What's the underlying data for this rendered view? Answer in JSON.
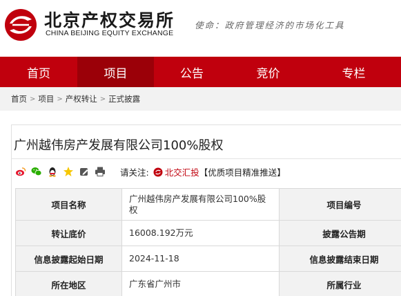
{
  "header": {
    "logo_cn": "北京产权交易所",
    "logo_en": "CHINA BEIJING EQUITY EXCHANGE",
    "mission": "使命：政府管理经济的市场化工具"
  },
  "nav": {
    "items": [
      {
        "label": "首页"
      },
      {
        "label": "项目"
      },
      {
        "label": "公告"
      },
      {
        "label": "竞价"
      },
      {
        "label": "专栏"
      }
    ],
    "active_index": 1
  },
  "breadcrumb": {
    "items": [
      "首页",
      "项目",
      "产权转让",
      "正式披露"
    ],
    "separator": ">"
  },
  "project": {
    "title": "广州越伟房产发展有限公司100%股权"
  },
  "share": {
    "icons": [
      "weibo-icon",
      "wechat-icon",
      "qq-icon",
      "qzone-star-icon",
      "edit-icon",
      "print-icon"
    ],
    "attention_label": "请关注:",
    "bjx_label": "北交汇投",
    "promo_label": "【优质项目精准推送】"
  },
  "info_table": {
    "rows": [
      {
        "label": "项目名称",
        "value": "广州越伟房产发展有限公司100%股权",
        "label2": "项目编号"
      },
      {
        "label": "转让底价",
        "value": "16008.192万元",
        "label2": "披露公告期"
      },
      {
        "label": "信息披露起始日期",
        "value": "2024-11-18",
        "label2": "信息披露结束日期"
      },
      {
        "label": "所在地区",
        "value": "广东省广州市",
        "label2": "所属行业"
      }
    ]
  },
  "colors": {
    "brand_red": "#c0000d",
    "nav_active": "#9b0008",
    "label_bg": "#f2f2f2"
  }
}
